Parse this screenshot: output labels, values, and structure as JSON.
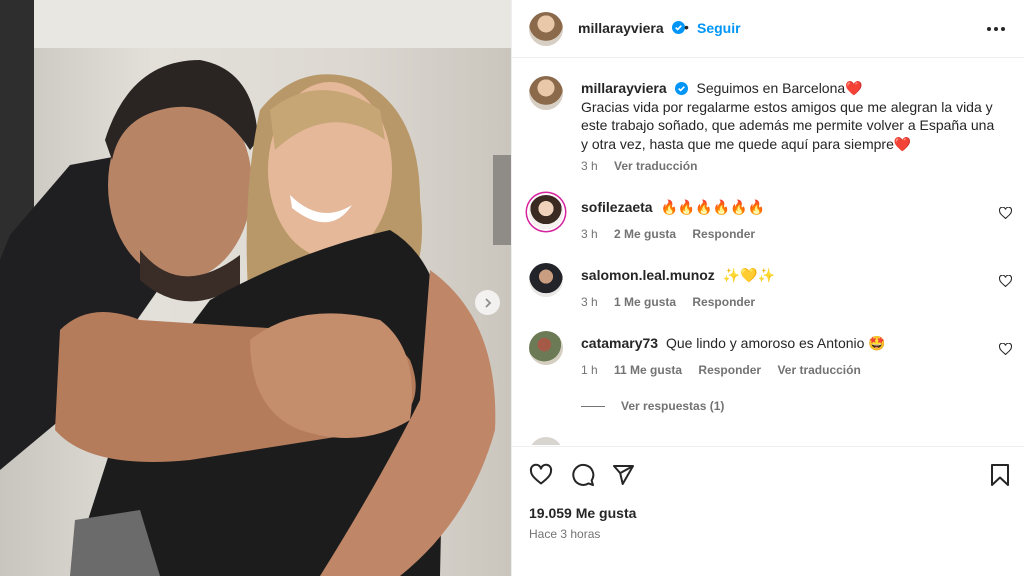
{
  "post": {
    "author": "millarayviera",
    "follow_label": "Seguir",
    "dot": "•",
    "caption_title": "Seguimos en Barcelona❤️",
    "caption_body": "Gracias vida por regalarme estos amigos que me alegran la vida y este trabajo soñado, que además me permite volver a España una y otra vez, hasta que me quede aquí para siempre❤️",
    "caption_time": "3 h",
    "caption_translate": "Ver traducción"
  },
  "comments": [
    {
      "user": "sofilezaeta",
      "text": "🔥🔥🔥🔥🔥🔥",
      "time": "3 h",
      "likes": "2 Me gusta",
      "reply": "Responder",
      "translate": ""
    },
    {
      "user": "salomon.leal.munoz",
      "text": "✨💛✨",
      "time": "3 h",
      "likes": "1 Me gusta",
      "reply": "Responder",
      "translate": ""
    },
    {
      "user": "catamary73",
      "text": "Que lindo y amoroso es Antonio 🤩",
      "time": "1 h",
      "likes": "11 Me gusta",
      "reply": "Responder",
      "translate": "Ver traducción"
    }
  ],
  "view_replies": "Ver respuestas (1)",
  "footer": {
    "likes": "19.059 Me gusta",
    "posted": "Hace 3 horas"
  },
  "colors": {
    "accent": "#0095f6",
    "verified": "#0095f6",
    "text": "#262626",
    "muted": "#737373",
    "heart": "#ed4956"
  },
  "icons": [
    "heart-icon",
    "comment-icon",
    "share-icon",
    "bookmark-icon",
    "more-icon",
    "verified-badge-icon",
    "chevron-right-icon"
  ]
}
